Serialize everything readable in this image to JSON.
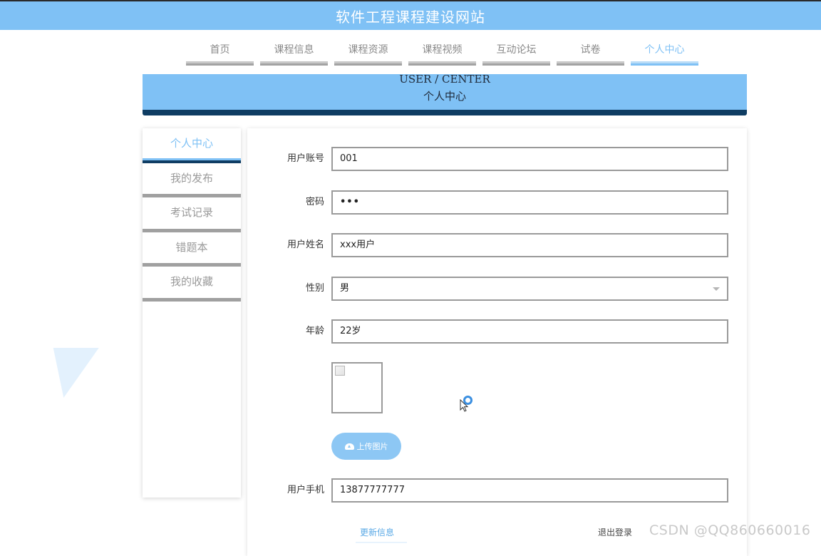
{
  "site_title": "软件工程课程建设网站",
  "nav": {
    "items": [
      {
        "label": "首页"
      },
      {
        "label": "课程信息"
      },
      {
        "label": "课程资源"
      },
      {
        "label": "课程视频"
      },
      {
        "label": "互动论坛"
      },
      {
        "label": "试卷"
      },
      {
        "label": "个人中心",
        "active": true
      }
    ]
  },
  "banner": {
    "title_en": "USER / CENTER",
    "title_cn": "个人中心"
  },
  "sidebar": {
    "items": [
      {
        "label": "个人中心",
        "active": true
      },
      {
        "label": "我的发布"
      },
      {
        "label": "考试记录"
      },
      {
        "label": "错题本"
      },
      {
        "label": "我的收藏"
      }
    ]
  },
  "form": {
    "account": {
      "label": "用户账号",
      "value": "001"
    },
    "password": {
      "label": "密码",
      "value": "•••"
    },
    "name": {
      "label": "用户姓名",
      "value": "xxx用户"
    },
    "gender": {
      "label": "性别",
      "value": "男"
    },
    "age": {
      "label": "年龄",
      "value": "22岁"
    },
    "upload_label": "上传图片",
    "phone": {
      "label": "用户手机",
      "value": "13877777777"
    },
    "update_label": "更新信息",
    "logout_label": "退出登录"
  },
  "watermark": "CSDN @QQ860660016",
  "colors": {
    "accent": "#7fc1f5",
    "dark_accent": "#0f3d63",
    "inactive": "#a3a3a3"
  }
}
